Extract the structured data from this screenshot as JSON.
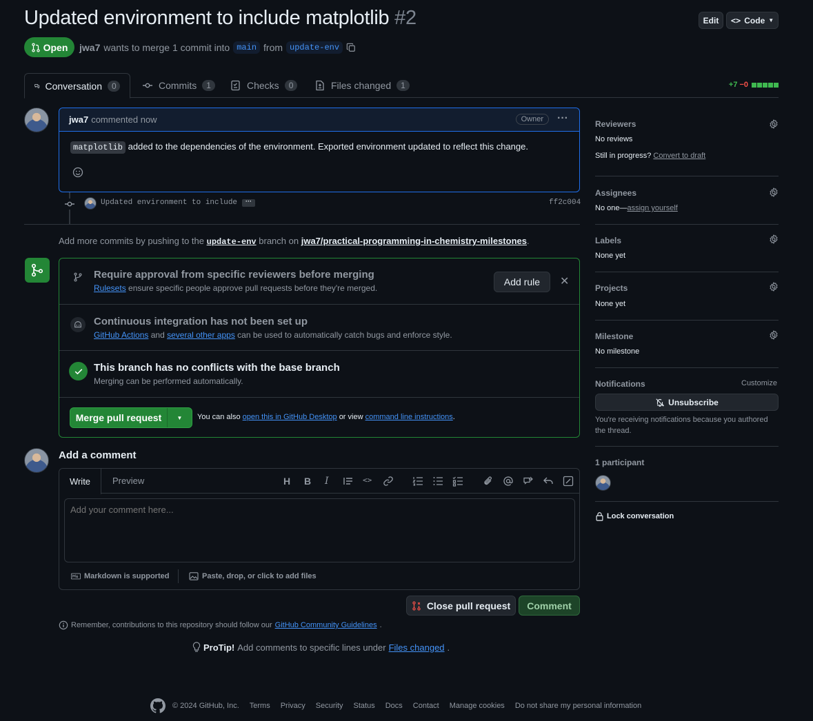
{
  "header": {
    "title": "Updated environment to include matplotlib",
    "number": "#2",
    "edit_label": "Edit",
    "code_label": "Code",
    "state_label": "Open",
    "author": "jwa7",
    "meta_mid": "wants to merge 1 commit into",
    "base_branch": "main",
    "from_word": "from",
    "head_branch": "update-env"
  },
  "tabs": [
    {
      "label": "Conversation",
      "count": "0"
    },
    {
      "label": "Commits",
      "count": "1"
    },
    {
      "label": "Checks",
      "count": "0"
    },
    {
      "label": "Files changed",
      "count": "1"
    }
  ],
  "diffstat": {
    "added": "+7",
    "removed": "−0"
  },
  "comment": {
    "author": "jwa7",
    "time": "commented now",
    "role": "Owner",
    "code": "matplotlib",
    "body": "added to the dependencies of the environment. Exported environment updated to reflect this change."
  },
  "commit": {
    "message": "Updated environment to include",
    "sha": "ff2c004"
  },
  "push_hint": {
    "pre": "Add more commits by pushing to the",
    "branch": "update-env",
    "mid": "branch on",
    "repo": "jwa7/practical-programming-in-chemistry-milestones",
    "post": "."
  },
  "merge": {
    "rule_title": "Require approval from specific reviewers before merging",
    "rule_link": "Rulesets",
    "rule_sub": "ensure specific people approve pull requests before they're merged.",
    "add_rule": "Add rule",
    "ci_title": "Continuous integration has not been set up",
    "ci_link1": "GitHub Actions",
    "ci_and": "and",
    "ci_link2": "several other apps",
    "ci_sub": "can be used to automatically catch bugs and enforce style.",
    "conf_title": "This branch has no conflicts with the base branch",
    "conf_sub": "Merging can be performed automatically.",
    "merge_btn": "Merge pull request",
    "also_pre": "You can also",
    "also_link1": "open this in GitHub Desktop",
    "also_mid": "or view",
    "also_link2": "command line instructions",
    "also_post": "."
  },
  "add_comment": {
    "heading": "Add a comment",
    "tab_write": "Write",
    "tab_preview": "Preview",
    "placeholder": "Add your comment here...",
    "markdown": "Markdown is supported",
    "attach": "Paste, drop, or click to add files",
    "close_btn": "Close pull request",
    "comment_btn": "Comment"
  },
  "notes": {
    "remember_pre": "Remember, contributions to this repository should follow our",
    "remember_link": "GitHub Community Guidelines",
    "remember_post": ".",
    "protip_bold": "ProTip!",
    "protip_text": "Add comments to specific lines under",
    "protip_link": "Files changed",
    "protip_post": "."
  },
  "sidebar": {
    "reviewers_h": "Reviewers",
    "reviewers_v": "No reviews",
    "progress": "Still in progress?",
    "draft_link": "Convert to draft",
    "assignees_h": "Assignees",
    "assignees_v": "No one—",
    "assign_link": "assign yourself",
    "labels_h": "Labels",
    "labels_v": "None yet",
    "projects_h": "Projects",
    "projects_v": "None yet",
    "milestone_h": "Milestone",
    "milestone_v": "No milestone",
    "notif_h": "Notifications",
    "customize": "Customize",
    "unsubscribe": "Unsubscribe",
    "notif_reason": "You're receiving notifications because you authored the thread.",
    "participants_h": "1 participant",
    "lock": "Lock conversation"
  },
  "footer": {
    "copyright": "© 2024 GitHub, Inc.",
    "links": [
      "Terms",
      "Privacy",
      "Security",
      "Status",
      "Docs",
      "Contact",
      "Manage cookies",
      "Do not share my personal information"
    ]
  },
  "colors": {
    "accent": "#4493f8",
    "green": "#238636",
    "bg": "#0d1117",
    "border": "#30363d"
  }
}
